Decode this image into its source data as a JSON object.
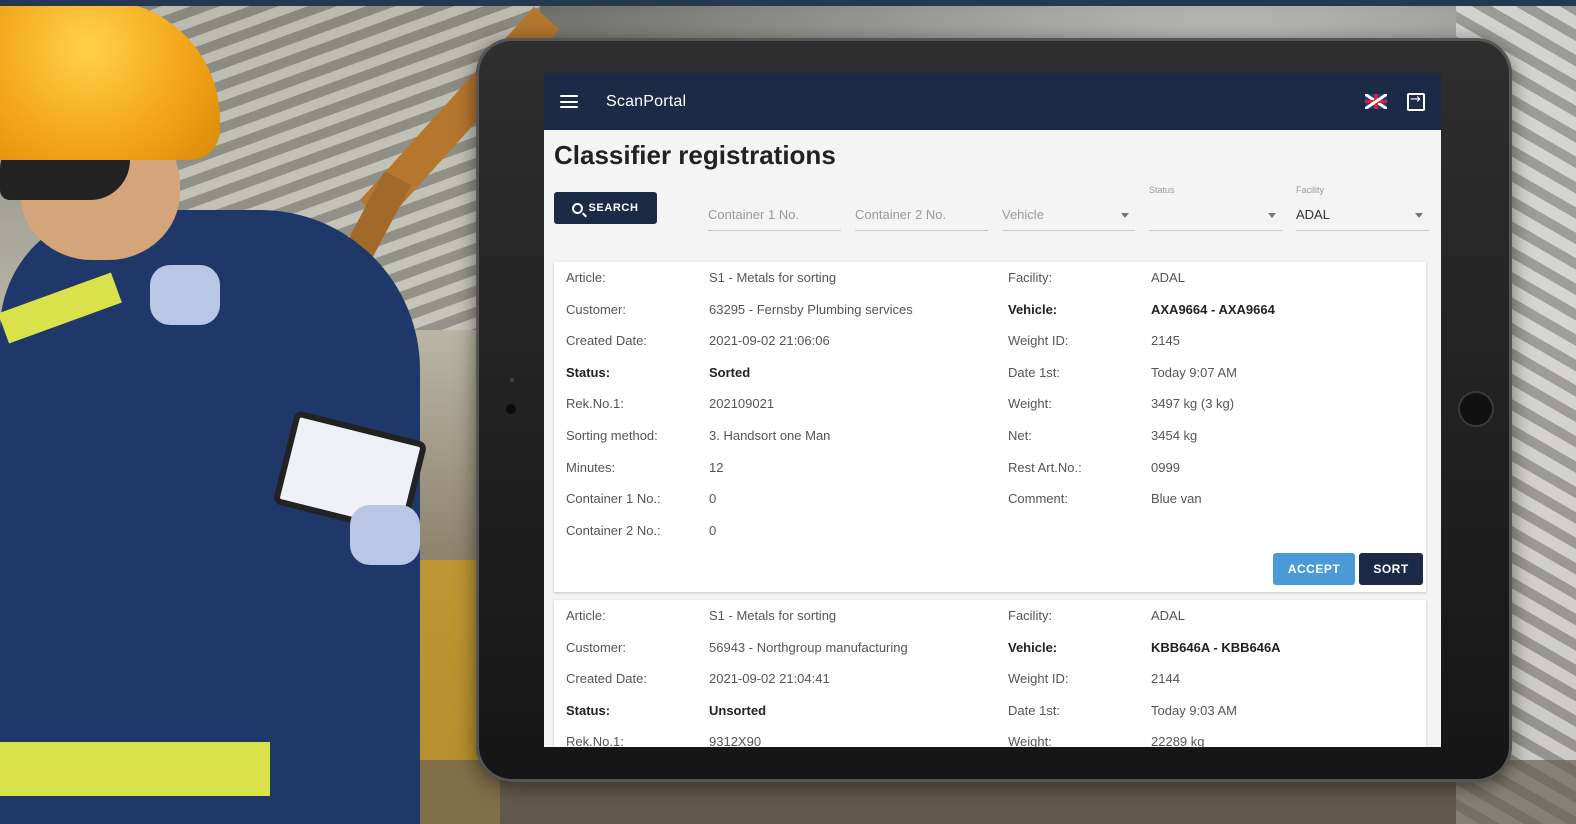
{
  "app": {
    "title": "ScanPortal"
  },
  "page": {
    "title": "Classifier registrations"
  },
  "filters": {
    "search_label": "SEARCH",
    "container1_placeholder": "Container 1 No.",
    "container2_placeholder": "Container 2 No.",
    "vehicle_placeholder": "Vehicle",
    "status_label": "Status",
    "status_value": "",
    "facility_label": "Facility",
    "facility_value": "ADAL"
  },
  "registrations": [
    {
      "left": [
        {
          "label": "Article:",
          "value": "S1 - Metals for sorting",
          "bold": false
        },
        {
          "label": "Customer:",
          "value": "63295 - Fernsby Plumbing services",
          "bold": false
        },
        {
          "label": "Created Date:",
          "value": "2021-09-02 21:06:06",
          "bold": false
        },
        {
          "label": "Status:",
          "value": "Sorted",
          "bold": true
        },
        {
          "label": "Rek.No.1:",
          "value": "202109021",
          "bold": false
        },
        {
          "label": "Sorting method:",
          "value": "3. Handsort one Man",
          "bold": false
        },
        {
          "label": "Minutes:",
          "value": "12",
          "bold": false
        },
        {
          "label": "Container 1 No.:",
          "value": "0",
          "bold": false
        },
        {
          "label": "Container 2 No.:",
          "value": "0",
          "bold": false
        }
      ],
      "right": [
        {
          "label": "Facility:",
          "value": "ADAL",
          "bold": false
        },
        {
          "label": "Vehicle:",
          "value": "AXA9664 - AXA9664",
          "bold": true
        },
        {
          "label": "Weight ID:",
          "value": "2145",
          "bold": false
        },
        {
          "label": "Date 1st:",
          "value": "Today 9:07 AM",
          "bold": false
        },
        {
          "label": "Weight:",
          "value": "3497 kg (3 kg)",
          "bold": false
        },
        {
          "label": "Net:",
          "value": "3454 kg",
          "bold": false
        },
        {
          "label": "Rest Art.No.:",
          "value": "0999",
          "bold": false
        },
        {
          "label": "Comment:",
          "value": "Blue van",
          "bold": false
        }
      ],
      "accept_label": "ACCEPT",
      "sort_label": "SORT"
    },
    {
      "left": [
        {
          "label": "Article:",
          "value": "S1 - Metals for sorting",
          "bold": false
        },
        {
          "label": "Customer:",
          "value": "56943 - Northgroup manufacturing",
          "bold": false
        },
        {
          "label": "Created Date:",
          "value": "2021-09-02 21:04:41",
          "bold": false
        },
        {
          "label": "Status:",
          "value": "Unsorted",
          "bold": true
        },
        {
          "label": "Rek.No.1:",
          "value": "9312X90",
          "bold": false
        }
      ],
      "right": [
        {
          "label": "Facility:",
          "value": "ADAL",
          "bold": false
        },
        {
          "label": "Vehicle:",
          "value": "KBB646A - KBB646A",
          "bold": true
        },
        {
          "label": "Weight ID:",
          "value": "2144",
          "bold": false
        },
        {
          "label": "Date 1st:",
          "value": "Today 9:03 AM",
          "bold": false
        },
        {
          "label": "Weight:",
          "value": "22289 kg",
          "bold": false
        }
      ]
    }
  ]
}
